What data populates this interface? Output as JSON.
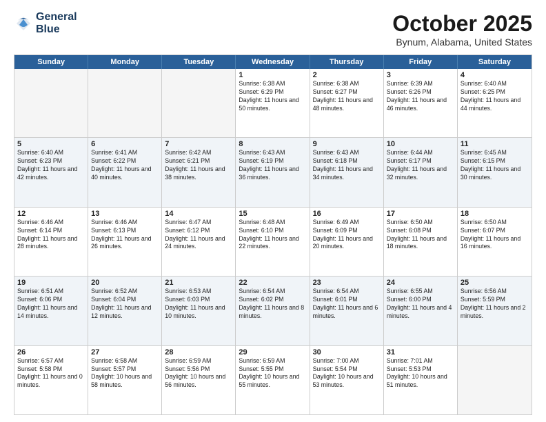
{
  "header": {
    "logo_line1": "General",
    "logo_line2": "Blue",
    "month_title": "October 2025",
    "location": "Bynum, Alabama, United States"
  },
  "days_of_week": [
    "Sunday",
    "Monday",
    "Tuesday",
    "Wednesday",
    "Thursday",
    "Friday",
    "Saturday"
  ],
  "rows": [
    [
      {
        "num": "",
        "text": ""
      },
      {
        "num": "",
        "text": ""
      },
      {
        "num": "",
        "text": ""
      },
      {
        "num": "1",
        "text": "Sunrise: 6:38 AM\nSunset: 6:29 PM\nDaylight: 11 hours\nand 50 minutes."
      },
      {
        "num": "2",
        "text": "Sunrise: 6:38 AM\nSunset: 6:27 PM\nDaylight: 11 hours\nand 48 minutes."
      },
      {
        "num": "3",
        "text": "Sunrise: 6:39 AM\nSunset: 6:26 PM\nDaylight: 11 hours\nand 46 minutes."
      },
      {
        "num": "4",
        "text": "Sunrise: 6:40 AM\nSunset: 6:25 PM\nDaylight: 11 hours\nand 44 minutes."
      }
    ],
    [
      {
        "num": "5",
        "text": "Sunrise: 6:40 AM\nSunset: 6:23 PM\nDaylight: 11 hours\nand 42 minutes."
      },
      {
        "num": "6",
        "text": "Sunrise: 6:41 AM\nSunset: 6:22 PM\nDaylight: 11 hours\nand 40 minutes."
      },
      {
        "num": "7",
        "text": "Sunrise: 6:42 AM\nSunset: 6:21 PM\nDaylight: 11 hours\nand 38 minutes."
      },
      {
        "num": "8",
        "text": "Sunrise: 6:43 AM\nSunset: 6:19 PM\nDaylight: 11 hours\nand 36 minutes."
      },
      {
        "num": "9",
        "text": "Sunrise: 6:43 AM\nSunset: 6:18 PM\nDaylight: 11 hours\nand 34 minutes."
      },
      {
        "num": "10",
        "text": "Sunrise: 6:44 AM\nSunset: 6:17 PM\nDaylight: 11 hours\nand 32 minutes."
      },
      {
        "num": "11",
        "text": "Sunrise: 6:45 AM\nSunset: 6:15 PM\nDaylight: 11 hours\nand 30 minutes."
      }
    ],
    [
      {
        "num": "12",
        "text": "Sunrise: 6:46 AM\nSunset: 6:14 PM\nDaylight: 11 hours\nand 28 minutes."
      },
      {
        "num": "13",
        "text": "Sunrise: 6:46 AM\nSunset: 6:13 PM\nDaylight: 11 hours\nand 26 minutes."
      },
      {
        "num": "14",
        "text": "Sunrise: 6:47 AM\nSunset: 6:12 PM\nDaylight: 11 hours\nand 24 minutes."
      },
      {
        "num": "15",
        "text": "Sunrise: 6:48 AM\nSunset: 6:10 PM\nDaylight: 11 hours\nand 22 minutes."
      },
      {
        "num": "16",
        "text": "Sunrise: 6:49 AM\nSunset: 6:09 PM\nDaylight: 11 hours\nand 20 minutes."
      },
      {
        "num": "17",
        "text": "Sunrise: 6:50 AM\nSunset: 6:08 PM\nDaylight: 11 hours\nand 18 minutes."
      },
      {
        "num": "18",
        "text": "Sunrise: 6:50 AM\nSunset: 6:07 PM\nDaylight: 11 hours\nand 16 minutes."
      }
    ],
    [
      {
        "num": "19",
        "text": "Sunrise: 6:51 AM\nSunset: 6:06 PM\nDaylight: 11 hours\nand 14 minutes."
      },
      {
        "num": "20",
        "text": "Sunrise: 6:52 AM\nSunset: 6:04 PM\nDaylight: 11 hours\nand 12 minutes."
      },
      {
        "num": "21",
        "text": "Sunrise: 6:53 AM\nSunset: 6:03 PM\nDaylight: 11 hours\nand 10 minutes."
      },
      {
        "num": "22",
        "text": "Sunrise: 6:54 AM\nSunset: 6:02 PM\nDaylight: 11 hours\nand 8 minutes."
      },
      {
        "num": "23",
        "text": "Sunrise: 6:54 AM\nSunset: 6:01 PM\nDaylight: 11 hours\nand 6 minutes."
      },
      {
        "num": "24",
        "text": "Sunrise: 6:55 AM\nSunset: 6:00 PM\nDaylight: 11 hours\nand 4 minutes."
      },
      {
        "num": "25",
        "text": "Sunrise: 6:56 AM\nSunset: 5:59 PM\nDaylight: 11 hours\nand 2 minutes."
      }
    ],
    [
      {
        "num": "26",
        "text": "Sunrise: 6:57 AM\nSunset: 5:58 PM\nDaylight: 11 hours\nand 0 minutes."
      },
      {
        "num": "27",
        "text": "Sunrise: 6:58 AM\nSunset: 5:57 PM\nDaylight: 10 hours\nand 58 minutes."
      },
      {
        "num": "28",
        "text": "Sunrise: 6:59 AM\nSunset: 5:56 PM\nDaylight: 10 hours\nand 56 minutes."
      },
      {
        "num": "29",
        "text": "Sunrise: 6:59 AM\nSunset: 5:55 PM\nDaylight: 10 hours\nand 55 minutes."
      },
      {
        "num": "30",
        "text": "Sunrise: 7:00 AM\nSunset: 5:54 PM\nDaylight: 10 hours\nand 53 minutes."
      },
      {
        "num": "31",
        "text": "Sunrise: 7:01 AM\nSunset: 5:53 PM\nDaylight: 10 hours\nand 51 minutes."
      },
      {
        "num": "",
        "text": ""
      }
    ]
  ]
}
